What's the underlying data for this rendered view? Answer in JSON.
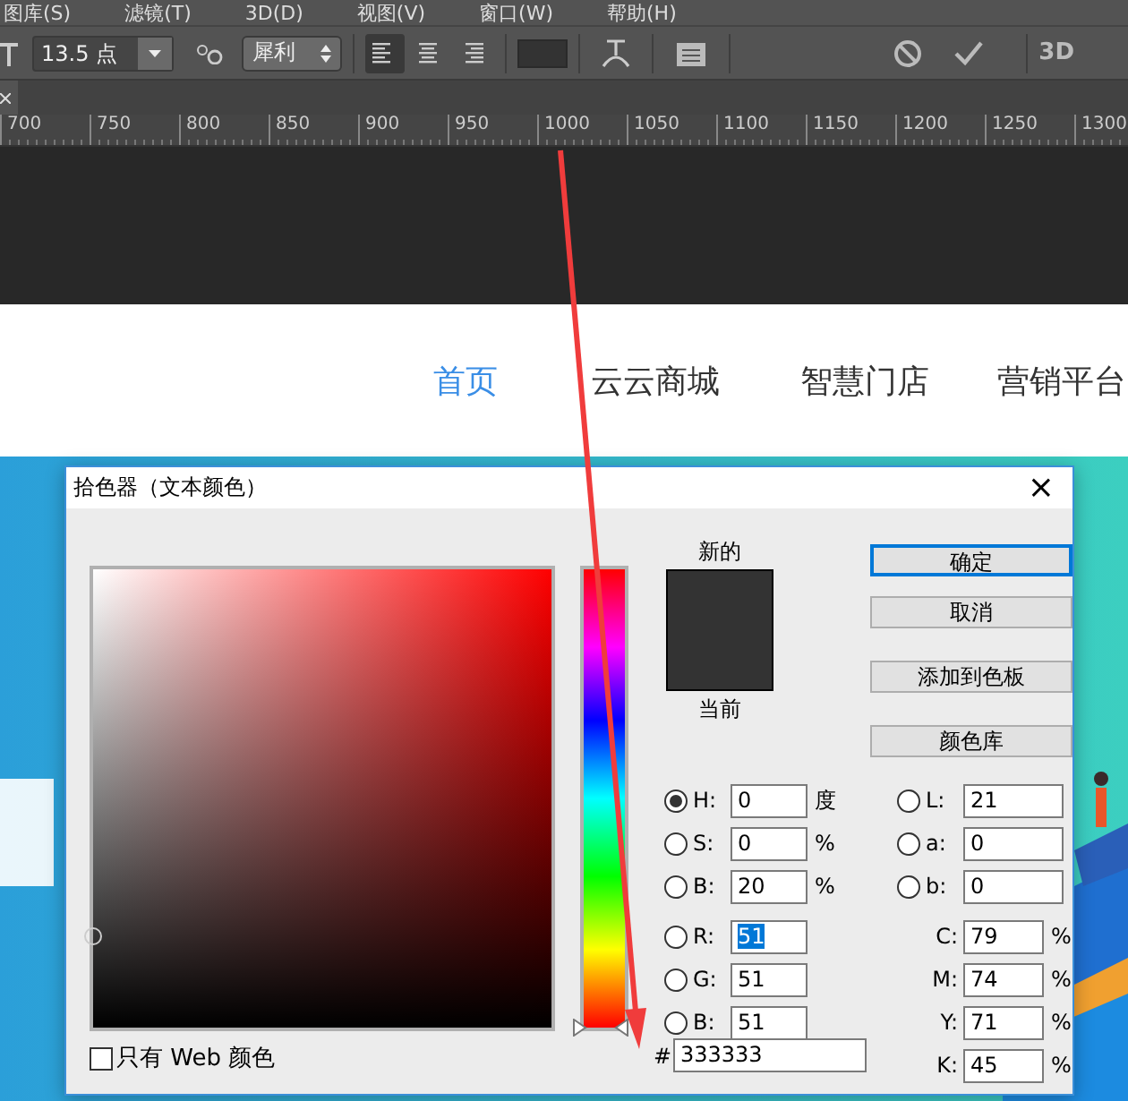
{
  "menu_bar": {
    "items": [
      "图库(S)",
      "滤镜(T)",
      "3D(D)",
      "视图(V)",
      "窗口(W)",
      "帮助(H)"
    ]
  },
  "options_bar": {
    "font_size": "13.5 点",
    "antialias": "犀利",
    "align_buttons": [
      {
        "kind": "left",
        "selected": true
      },
      {
        "kind": "center",
        "selected": false
      },
      {
        "kind": "right",
        "selected": false
      }
    ],
    "three_d": "3D"
  },
  "ruler": {
    "labels": [
      "700",
      "750",
      "800",
      "850",
      "900",
      "950",
      "1000",
      "1050",
      "1100",
      "1150",
      "1200",
      "1250",
      "1300"
    ]
  },
  "website_nav": {
    "items": [
      {
        "label": "首页",
        "selected": true
      },
      {
        "label": "云云商城",
        "selected": false
      },
      {
        "label": "智慧门店",
        "selected": false
      },
      {
        "label": "营销平台",
        "selected": false
      }
    ]
  },
  "color_picker": {
    "title": "拾色器（文本颜色）",
    "close": "×",
    "new_label": "新的",
    "current_label": "当前",
    "buttons": [
      {
        "label": "确定",
        "default": true
      },
      {
        "label": "取消",
        "default": false
      },
      {
        "label": "添加到色板",
        "default": false
      },
      {
        "label": "颜色库",
        "default": false
      }
    ],
    "hsb_rgb_fields": [
      {
        "label": "H:",
        "value": "0",
        "unit": "度",
        "selected": true,
        "highlighted": false
      },
      {
        "label": "S:",
        "value": "0",
        "unit": "%",
        "selected": false,
        "highlighted": false
      },
      {
        "label": "B:",
        "value": "20",
        "unit": "%",
        "selected": false,
        "highlighted": false
      },
      {
        "label": "R:",
        "value": "51",
        "selected": false,
        "highlighted": true
      },
      {
        "label": "G:",
        "value": "51",
        "selected": false,
        "highlighted": false
      },
      {
        "label": "B:",
        "value": "51",
        "selected": false,
        "highlighted": false
      }
    ],
    "lab_fields": [
      {
        "label": "L:",
        "value": "21",
        "selected": false
      },
      {
        "label": "a:",
        "value": "0",
        "selected": false
      },
      {
        "label": "b:",
        "value": "0",
        "selected": false
      }
    ],
    "cmyk_fields": [
      {
        "label": "C:",
        "value": "79",
        "unit": "%"
      },
      {
        "label": "M:",
        "value": "74",
        "unit": "%"
      },
      {
        "label": "Y:",
        "value": "71",
        "unit": "%"
      },
      {
        "label": "K:",
        "value": "45",
        "unit": "%"
      }
    ],
    "hue_slider": {
      "level": 0
    },
    "hex_label": "#",
    "hex": "333333",
    "web_only": {
      "label": "只有 Web 颜色",
      "checked": false
    }
  }
}
